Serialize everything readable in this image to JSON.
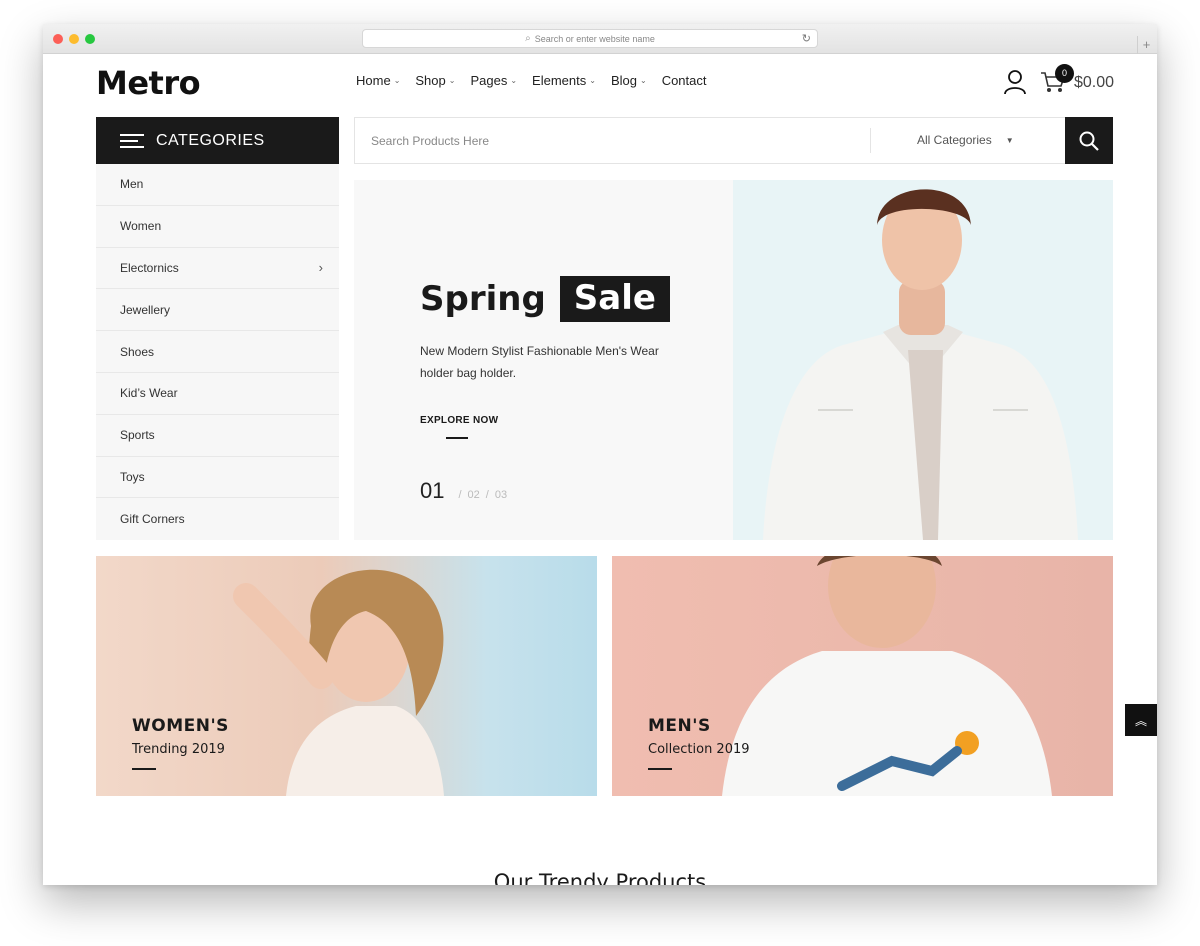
{
  "browser": {
    "address_placeholder": "Search or enter website name"
  },
  "header": {
    "logo": "Metro",
    "nav": [
      {
        "label": "Home"
      },
      {
        "label": "Shop"
      },
      {
        "label": "Pages"
      },
      {
        "label": "Elements"
      },
      {
        "label": "Blog"
      },
      {
        "label": "Contact"
      }
    ],
    "cart_count": "0",
    "cart_total": "$0.00"
  },
  "categories": {
    "title": "CATEGORIES",
    "items": [
      {
        "label": "Men"
      },
      {
        "label": "Women"
      },
      {
        "label": "Electornics"
      },
      {
        "label": "Jewellery"
      },
      {
        "label": "Shoes"
      },
      {
        "label": "Kid’s Wear"
      },
      {
        "label": "Sports"
      },
      {
        "label": "Toys"
      },
      {
        "label": "Gift Corners"
      }
    ]
  },
  "search": {
    "placeholder": "Search Products Here",
    "category": "All Categories"
  },
  "hero": {
    "title_main": "Spring",
    "title_highlight": "Sale",
    "subtitle": "New Modern Stylist Fashionable Men's Wear holder bag holder.",
    "cta": "EXPLORE NOW",
    "slide_current": "01",
    "slide_2": "02",
    "slide_3": "03"
  },
  "banners": {
    "women": {
      "title": "WOMEN'S",
      "subtitle": "Trending 2019"
    },
    "men": {
      "title": "MEN'S",
      "subtitle": "Collection 2019"
    }
  },
  "section_title": "Our Trendy Products",
  "colors": {
    "accent": "#1a1a1a",
    "hero_image_bg": "#e8f4f6"
  }
}
